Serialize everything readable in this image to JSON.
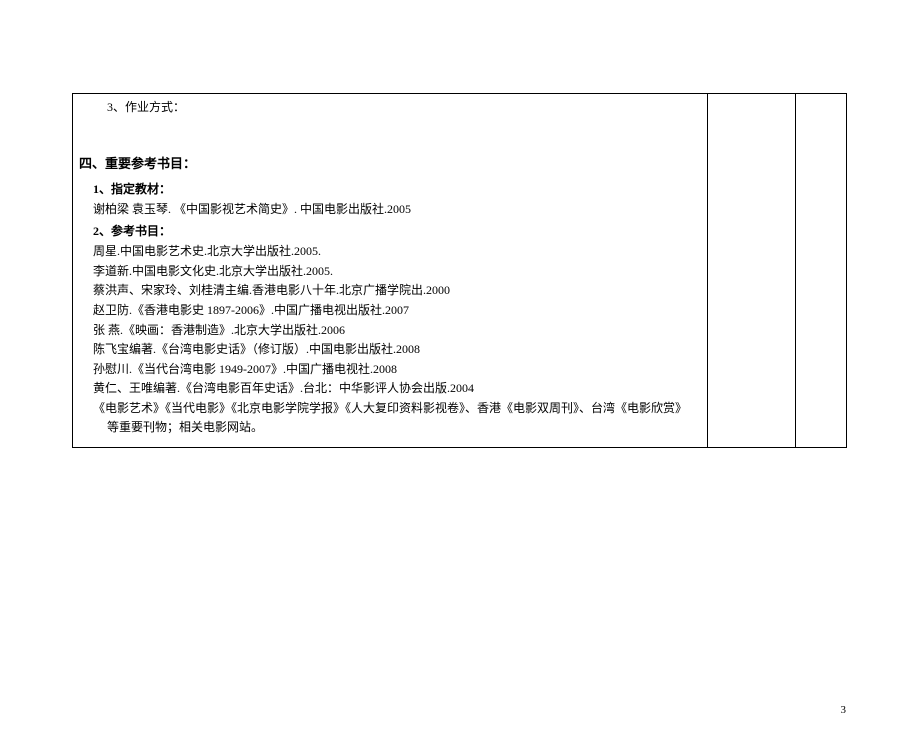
{
  "assignment_label": "3、作业方式：",
  "section_heading": "四、重要参考书目：",
  "subheading_textbook": "1、指定教材：",
  "textbook_entry": "谢柏梁  袁玉琴.  《中国影视艺术简史》. 中国电影出版社.2005",
  "subheading_references": "2、参考书目：",
  "references": [
    "周星.中国电影艺术史.北京大学出版社.2005.",
    "李道新.中国电影文化史.北京大学出版社.2005.",
    "蔡洪声、宋家玲、刘桂清主编.香港电影八十年.北京广播学院出.2000",
    "赵卫防.《香港电影史 1897-2006》.中国广播电视出版社.2007",
    "张 燕.《映画：香港制造》.北京大学出版社.2006",
    "陈飞宝编著.《台湾电影史话》（修订版）.中国电影出版社.2008",
    "孙慰川.《当代台湾电影 1949-2007》.中国广播电视社.2008",
    "黄仁、王唯编著.《台湾电影百年史话》.台北：中华影评人协会出版.2004"
  ],
  "closing_line": "《电影艺术》《当代电影》《北京电影学院学报》《人大复印资料影视卷》、香港《电影双周刊》、台湾《电影欣赏》等重要刊物；相关电影网站。",
  "page_number": "3"
}
